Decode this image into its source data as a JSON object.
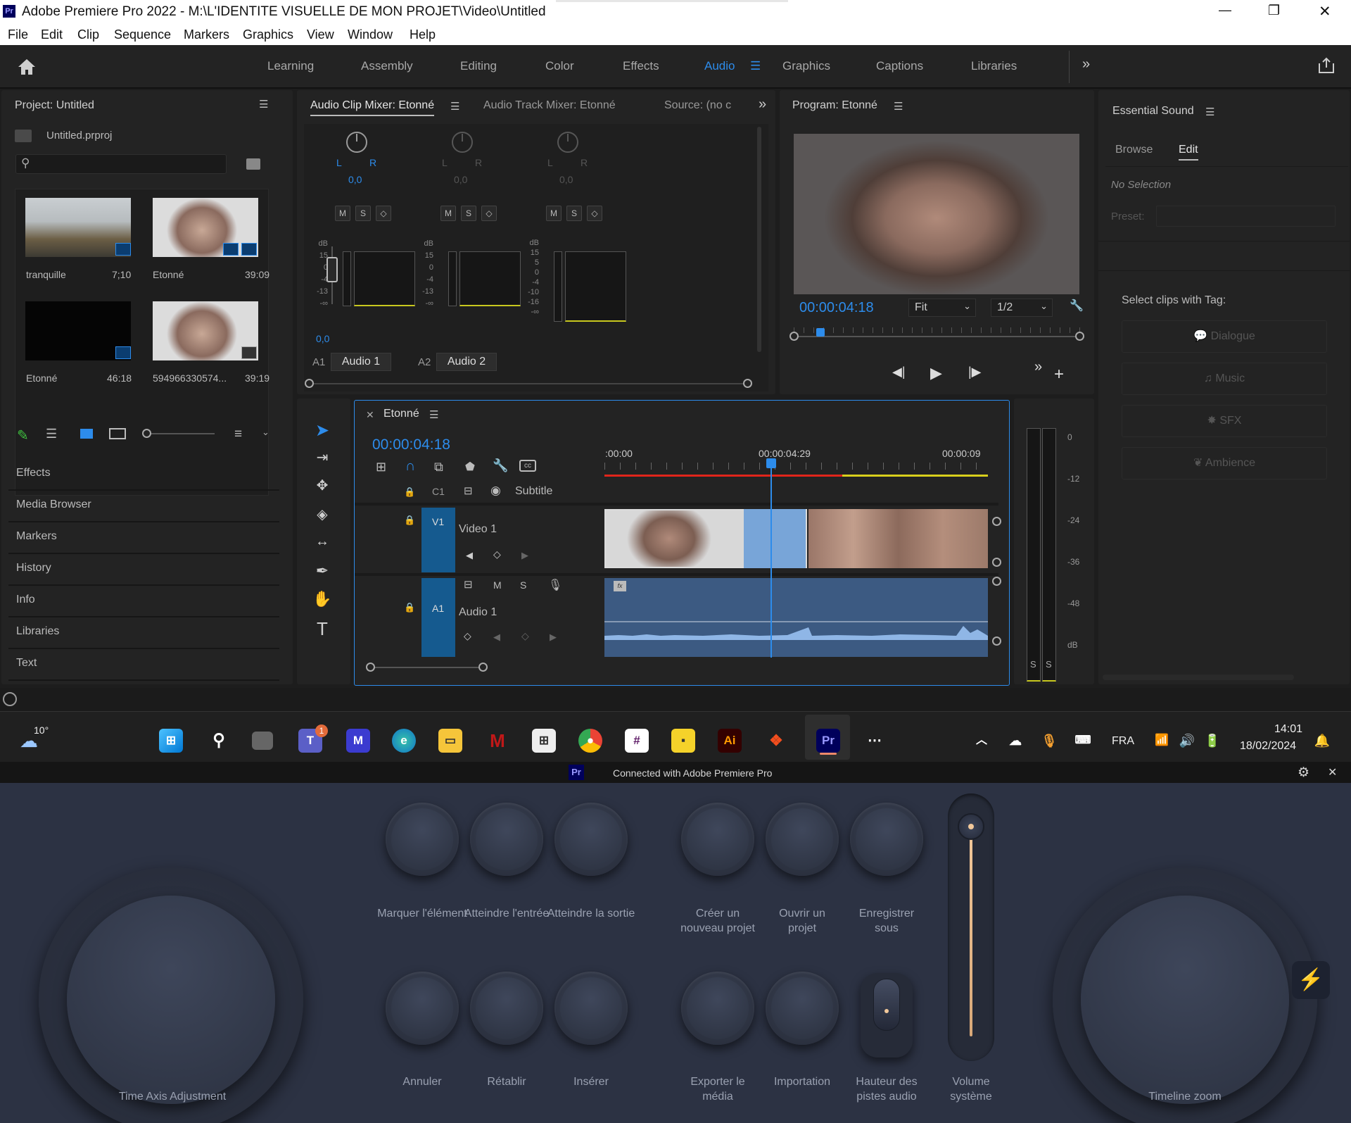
{
  "window": {
    "app_icon": "Pr",
    "title": "Adobe Premiere Pro 2022 - M:\\L'IDENTITE VISUELLE DE MON PROJET\\Video\\Untitled",
    "minimize": "—",
    "maximize": "❐",
    "close": "✕"
  },
  "menu": [
    "File",
    "Edit",
    "Clip",
    "Sequence",
    "Markers",
    "Graphics",
    "View",
    "Window",
    "Help"
  ],
  "workspaces": [
    "Learning",
    "Assembly",
    "Editing",
    "Color",
    "Effects",
    "Audio",
    "Graphics",
    "Captions",
    "Libraries"
  ],
  "workspace_active": "Audio",
  "project": {
    "title": "Project: Untitled",
    "file": "Untitled.prproj",
    "items": [
      {
        "name": "tranquille",
        "duration": "7;10"
      },
      {
        "name": "Etonné",
        "duration": "39:09"
      },
      {
        "name": "Etonné",
        "duration": "46:18"
      },
      {
        "name": "594966330574...",
        "duration": "39:19"
      }
    ]
  },
  "left_panels": [
    "Effects",
    "Media Browser",
    "Markers",
    "History",
    "Info",
    "Libraries",
    "Text"
  ],
  "mixer": {
    "tabs": [
      "Audio Clip Mixer: Etonné",
      "Audio Track Mixer: Etonné",
      "Source: (no c"
    ],
    "channels": [
      {
        "lr": "L",
        "r": "R",
        "value": "0,0",
        "track": "A1",
        "name": "Audio 1"
      },
      {
        "lr": "L",
        "r": "R",
        "value": "0,0",
        "track": "A2",
        "name": "Audio 2"
      },
      {
        "lr": "L",
        "r": "R",
        "value": "0,0"
      }
    ],
    "buttons": [
      "M",
      "S",
      "◇"
    ],
    "scale_a": [
      "dB",
      "15",
      "0",
      "-4",
      "-13",
      "-∞"
    ],
    "scale_b": [
      "dB",
      "15",
      "5",
      "0",
      "-4",
      "-10",
      "-16",
      "-∞"
    ],
    "fader_value": "0,0"
  },
  "program": {
    "title": "Program: Etonné",
    "timecode": "00:00:04:18",
    "fit": "Fit",
    "res": "1/2"
  },
  "essential": {
    "title": "Essential Sound",
    "tabs": [
      "Browse",
      "Edit"
    ],
    "no_selection": "No Selection",
    "preset": "Preset:",
    "tag_label": "Select clips with Tag:",
    "tags": [
      "Dialogue",
      "Music",
      "SFX",
      "Ambience"
    ]
  },
  "timeline": {
    "title": "Etonné",
    "timecode": "00:00:04:18",
    "ruler": [
      ":00:00",
      "00:00:04:29",
      "00:00:09"
    ],
    "tracks": [
      {
        "id": "C1",
        "name": "Subtitle"
      },
      {
        "id": "V1",
        "name": "Video 1"
      },
      {
        "id": "A1",
        "name": "Audio 1"
      }
    ],
    "ms": [
      "M",
      "S"
    ],
    "meter_scale": [
      "0",
      "-12",
      "-24",
      "-36",
      "-48",
      "dB"
    ],
    "meter_solo": [
      "S",
      "S"
    ]
  },
  "taskbar": {
    "weather": "10°",
    "teams_badge": "1",
    "lang": "FRA",
    "time": "14:01",
    "date": "18/02/2024"
  },
  "console": {
    "status": "Connected with Adobe Premiere Pro",
    "dials": [
      "Time Axis Adjustment",
      "Timeline zoom"
    ],
    "buttons_top": [
      "Marquer l'élément",
      "Atteindre l'entrée",
      "Atteindre la sortie",
      "Créer un nouveau projet",
      "Ouvrir un projet",
      "Enregistrer sous"
    ],
    "buttons_bottom": [
      "Annuler",
      "Rétablir",
      "Insérer",
      "Exporter le média",
      "Importation",
      "Hauteur des pistes audio"
    ],
    "slider": "Volume système"
  }
}
